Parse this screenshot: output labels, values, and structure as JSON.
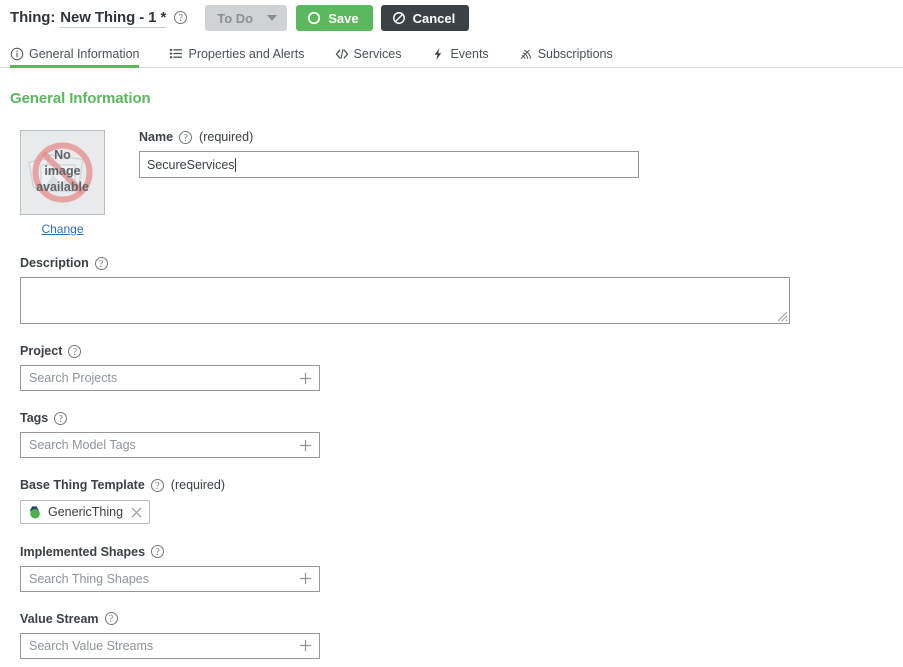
{
  "header": {
    "title_prefix": "Thing:",
    "title_name": "New Thing - 1 *",
    "help_glyph": "?",
    "state_button": {
      "label": "To Do",
      "icon": "chevron-down-icon"
    },
    "save_button": {
      "label": "Save",
      "icon": "circle-icon",
      "color": "#5cb85c"
    },
    "cancel_button": {
      "label": "Cancel",
      "icon": "no-entry-icon",
      "color": "#3b4246"
    }
  },
  "tabs": [
    {
      "label": "General Information",
      "icon": "info-circle-icon",
      "active": true
    },
    {
      "label": "Properties and Alerts",
      "icon": "list-icon",
      "active": false
    },
    {
      "label": "Services",
      "icon": "code-brackets-icon",
      "active": false
    },
    {
      "label": "Events",
      "icon": "lightning-bolt-icon",
      "active": false
    },
    {
      "label": "Subscriptions",
      "icon": "rss-waves-icon",
      "active": false
    }
  ],
  "section": {
    "title": "General Information",
    "accent_color": "#5cb85c"
  },
  "image": {
    "placeholder_lines": [
      "No",
      "image",
      "available"
    ],
    "change_label": "Change"
  },
  "fields": {
    "name": {
      "label": "Name",
      "required_note": "(required)",
      "value": "SecureServices"
    },
    "description": {
      "label": "Description",
      "value": ""
    },
    "project": {
      "label": "Project",
      "placeholder": "Search Projects"
    },
    "tags": {
      "label": "Tags",
      "placeholder": "Search Model Tags"
    },
    "base_thing_template": {
      "label": "Base Thing Template",
      "required_note": "(required)",
      "chip": {
        "label": "GenericThing",
        "icon": "thing-template-icon",
        "remove_icon": "close-x-icon"
      }
    },
    "implemented_shapes": {
      "label": "Implemented Shapes",
      "placeholder": "Search Thing Shapes"
    },
    "value_stream": {
      "label": "Value Stream",
      "placeholder": "Search Value Streams"
    }
  }
}
